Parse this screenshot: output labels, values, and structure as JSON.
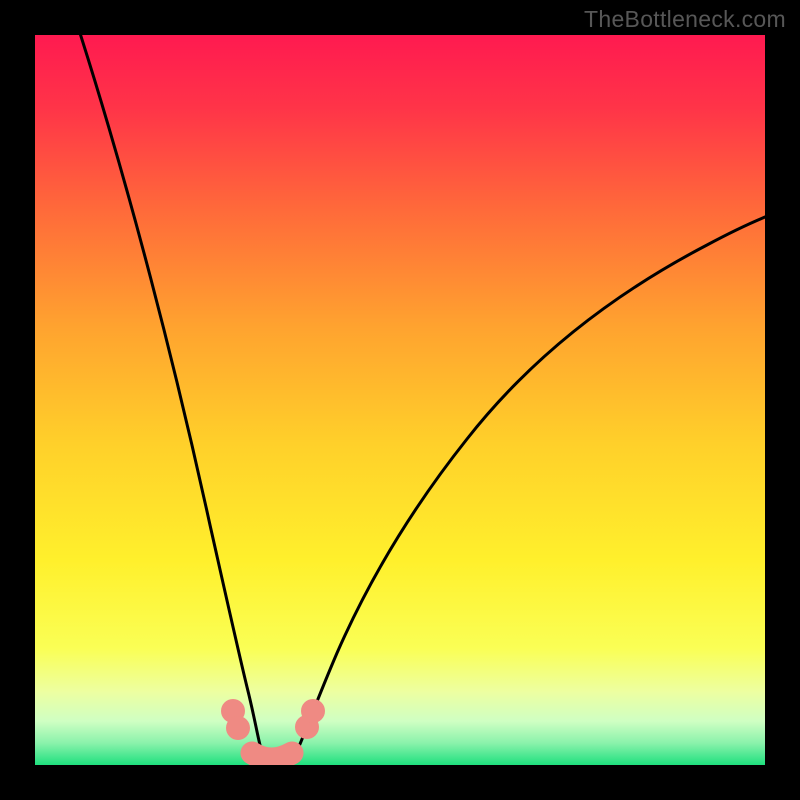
{
  "watermark": "TheBottleneck.com",
  "colors": {
    "bg": "#000000",
    "curve": "#000000",
    "marker": "#ef8a83",
    "gradient_top": "#ff1a4f",
    "gradient_mid": "#ffe629",
    "gradient_low": "#f6ff99",
    "gradient_bottom": "#1fe07e"
  },
  "chart_data": {
    "type": "line",
    "title": "",
    "xlabel": "",
    "ylabel": "",
    "xlim": [
      0,
      100
    ],
    "ylim": [
      0,
      100
    ],
    "series": [
      {
        "name": "left-branch",
        "x": [
          6,
          9,
          12,
          15,
          18,
          20.5,
          23,
          25,
          26.5,
          27.8,
          28.8,
          29.5
        ],
        "y": [
          100,
          85,
          70,
          56,
          42,
          31,
          20,
          12,
          7,
          3.4,
          1.6,
          0.8
        ]
      },
      {
        "name": "valley",
        "x": [
          29.5,
          30.2,
          31,
          32,
          33,
          34,
          35,
          35.8
        ],
        "y": [
          0.8,
          0.4,
          0.2,
          0.15,
          0.15,
          0.2,
          0.35,
          0.6
        ]
      },
      {
        "name": "right-branch",
        "x": [
          35.8,
          37.5,
          41,
          46,
          52,
          59,
          67,
          76,
          86,
          96,
          100
        ],
        "y": [
          0.6,
          1.6,
          5.4,
          12.5,
          21,
          30,
          39,
          47.8,
          55.8,
          62.3,
          64.5
        ]
      }
    ],
    "markers": {
      "left_pair": [
        {
          "x": 27.0,
          "y": 5.4
        },
        {
          "x": 27.8,
          "y": 3.4
        }
      ],
      "right_pair": [
        {
          "x": 36.9,
          "y": 3.1
        },
        {
          "x": 37.4,
          "y": 4.6
        }
      ],
      "bottom_segment": {
        "x0": 29.8,
        "x1": 35.3,
        "y": 0.55
      }
    }
  }
}
